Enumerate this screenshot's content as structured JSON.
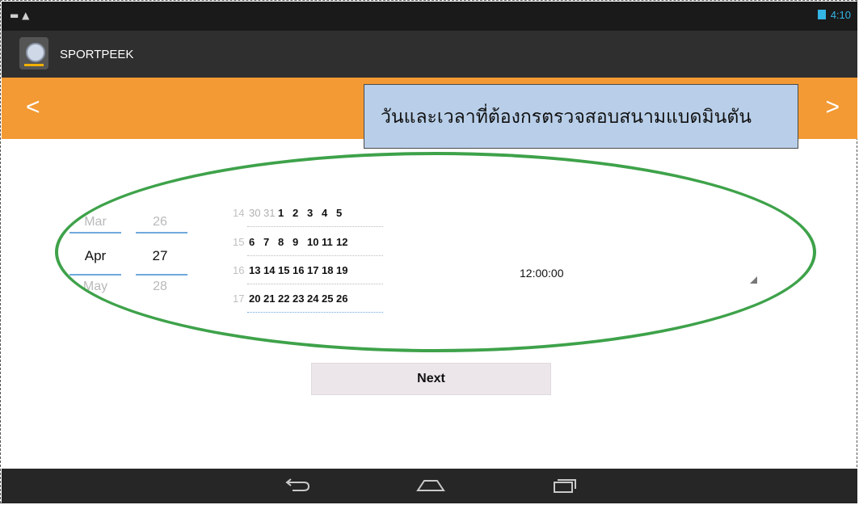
{
  "status_bar": {
    "time": "4:10",
    "left_icons": "▬ ▲"
  },
  "app": {
    "title": "SPORTPEEK"
  },
  "banner": {
    "prev": "<",
    "next": ">"
  },
  "callout": {
    "text": "วันและเวลาที่ต้องกรตรวจสอบสนามแบดมินตัน"
  },
  "date_picker": {
    "month": {
      "prev": "Mar",
      "current": "Apr",
      "next": "May"
    },
    "day": {
      "prev": "26",
      "current": "27",
      "next": "28"
    }
  },
  "calendar": {
    "weeks": [
      {
        "week": "14",
        "days": [
          "30",
          "31",
          "1",
          "2",
          "3",
          "4",
          "5"
        ]
      },
      {
        "week": "15",
        "days": [
          "6",
          "7",
          "8",
          "9",
          "10",
          "11",
          "12"
        ]
      },
      {
        "week": "16",
        "days": [
          "13",
          "14",
          "15",
          "16",
          "17",
          "18",
          "19"
        ]
      },
      {
        "week": "17",
        "days": [
          "20",
          "21",
          "22",
          "23",
          "24",
          "25",
          "26"
        ]
      }
    ]
  },
  "time": {
    "value": "12:00:00"
  },
  "actions": {
    "next_label": "Next"
  },
  "nav_icons": [
    "back-icon",
    "home-icon",
    "recent-apps-icon"
  ],
  "colors": {
    "banner": "#f39a34",
    "callout": "#b9cfe9",
    "highlight_ellipse": "#3ea24a",
    "divider": "#6fa9dc"
  }
}
